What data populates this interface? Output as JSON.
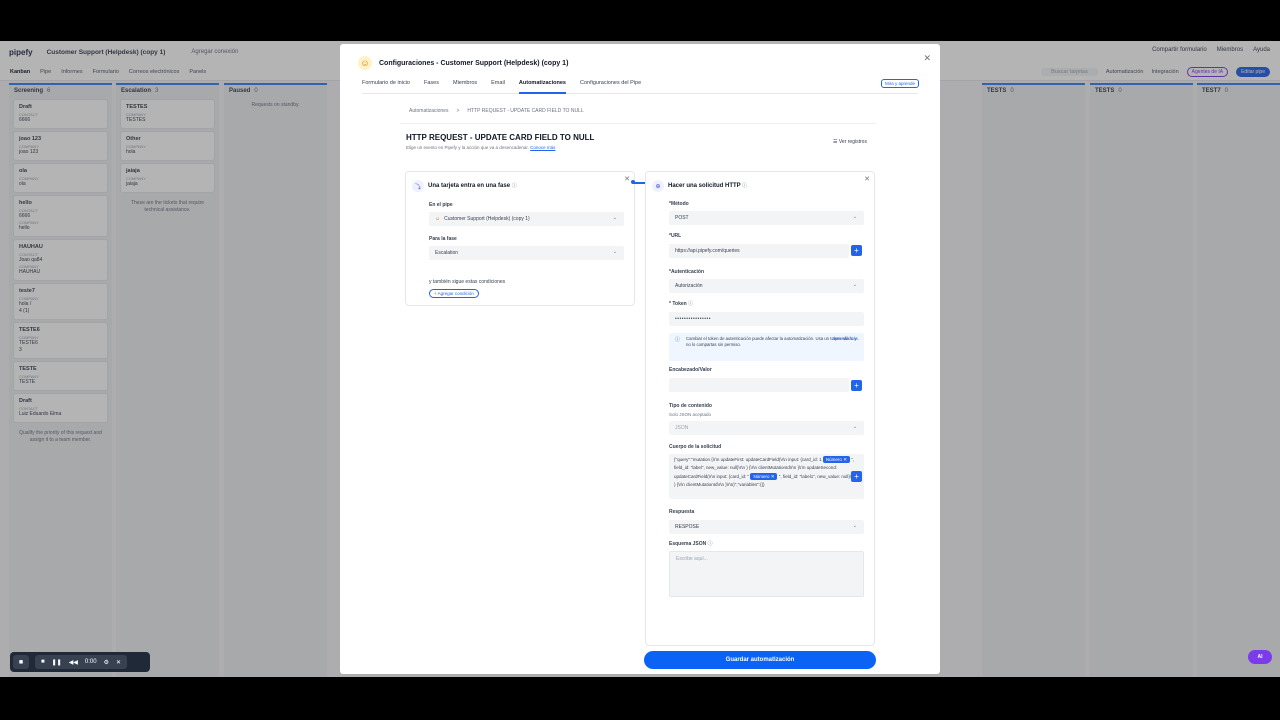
{
  "app": {
    "logo": "pipefy",
    "pipe_title": "Customer Support (Helpdesk) (copy 1)",
    "add_connection": "Agregar conexión",
    "top_right": [
      "Compartir formulario",
      "Miembros",
      "Ayuda"
    ],
    "nav": [
      "Kanban",
      "Pipe",
      "Informes",
      "Formulario",
      "Correos electrónicos",
      "Panels"
    ],
    "search_placeholder": "Buscar tarjetas",
    "nav_right": [
      "Automatización",
      "Integración"
    ],
    "ai_agents": "Agentes de IA",
    "edit_pipe": "Editar pipe"
  },
  "columns": [
    {
      "name": "Screening",
      "count": "6"
    },
    {
      "name": "Escalation",
      "count": "3"
    },
    {
      "name": "Paused",
      "count": "0"
    },
    {
      "name": "TESTS",
      "count": "0"
    },
    {
      "name": "TESTS",
      "count": "0"
    },
    {
      "name": "TEST7",
      "count": "0"
    }
  ],
  "screening_cards": [
    {
      "title": "Draft",
      "field": "CONTACT",
      "value": "6666"
    },
    {
      "title": "joao 123",
      "field": "COMPANY",
      "value": "joao 123"
    },
    {
      "title": "ola",
      "field": "COMPANY",
      "value": "ola"
    },
    {
      "title": "hello",
      "field": "CONTACT",
      "value": "6666",
      "field2": "COMPANY",
      "value2": "hello"
    },
    {
      "title": "HAUHAU",
      "field": "CONTACT",
      "value": "Joao qa84",
      "field2": "COMPANY",
      "value2": "HAUHAU"
    },
    {
      "title": "teste7",
      "field": "COMPANY",
      "value": "hola /",
      "extra": "4 (1)"
    },
    {
      "title": "TESTE6",
      "field": "COMPANY",
      "value": "TESTE6",
      "extra": "3"
    },
    {
      "title": "TESTE",
      "field": "COMPANY",
      "value": "TESTE"
    },
    {
      "title": "Draft",
      "field": "CONTACT",
      "value": "Luiz Eduardo Elma"
    }
  ],
  "screening_note": "Qualify the priority of this request and assign it to a team member.",
  "escalation_cards": [
    {
      "title": "TESTES",
      "field": "COMPANY",
      "value": "TESTES"
    },
    {
      "title": "Other",
      "field": "COMPANY",
      "value": "hola"
    },
    {
      "title": "jaiaja",
      "field": "COMPANY",
      "value": "jaiaja"
    }
  ],
  "escalation_note": "These are the tickets that require technical assistance.",
  "paused_note": "Requests on standby.",
  "recorder": {
    "time": "0:00"
  },
  "ai_badge": "AI",
  "modal": {
    "title": "Configuraciones - Customer Support (Helpdesk) (copy 1)",
    "tabs": [
      "Formulario de inicio",
      "Fases",
      "Miembros",
      "Email",
      "Automatizaciones",
      "Configuraciones del Pipe"
    ],
    "learn_btn": "Mira y aprende",
    "breadcrumb": [
      "Automatizaciones",
      ">",
      "HTTP REQUEST - UPDATE CARD FIELD TO NULL"
    ],
    "automation_title": "HTTP REQUEST - UPDATE CARD FIELD TO NULL",
    "automation_sub": "Elige un evento en Pipefy y la acción que va a desencadenar.",
    "automation_sub_link": "Conoce más",
    "logs_link": "Ver registros",
    "left_panel": {
      "title": "Una tarjeta entra en una fase",
      "pipe_label": "En el pipe",
      "pipe_value": "Customer Support (Helpdesk) (copy 1)",
      "phase_label": "Para la fase",
      "phase_value": "Escalation",
      "conditions_label": "y también sigue estas condiciones",
      "add_condition": "Agregar condición"
    },
    "right_panel": {
      "title": "Hacer una solicitud HTTP",
      "method_label": "*Método",
      "method_value": "POST",
      "url_label": "*URL",
      "url_value": "https://api.pipefy.com/queries",
      "auth_label": "*Autenticación",
      "auth_value": "Autorización",
      "token_label": "* Token",
      "token_value": "••••••••••••••••",
      "info_text": "Cambiar el token de autenticación puede afectar la automatización. Usa un token válido y no lo compartas sin permiso.",
      "info_link": "Aprende más.",
      "header_label": "Encabezado/Valor",
      "content_type_label": "Tipo de contenido",
      "content_type_sub": "Solo JSON aceptado",
      "content_type_value": "JSON",
      "body_label": "Cuerpo de la solicitud",
      "body_part1": "{\"query\":\"mutation {\\r\\n  updateFirst: updateCardField(\\r\\n    input: {card_id:",
      "body_part2": "1",
      "tag_label": "Número",
      "body_part3": "\", field_id: \"label\", new_value: null}\\r\\n  ) {\\r\\n",
      "body_part4": "clientMutationId\\r\\n  }\\r\\n  updateSecond: updateCardField(\\r\\n    input:",
      "body_part5": "{card_id: \"",
      "body_part6": "\", field_id: \"label1\", new_value: null}\\r\\n  ) {\\r\\n",
      "body_part7": "clientMutationId\\r\\n  }\\r\\n}\",\"variables\":{}}",
      "response_label": "Respuesta",
      "response_value": "RESPOSE",
      "schema_label": "Esquema JSON",
      "schema_placeholder": "Escribe aquí..."
    },
    "save_btn": "Guardar automatización"
  }
}
